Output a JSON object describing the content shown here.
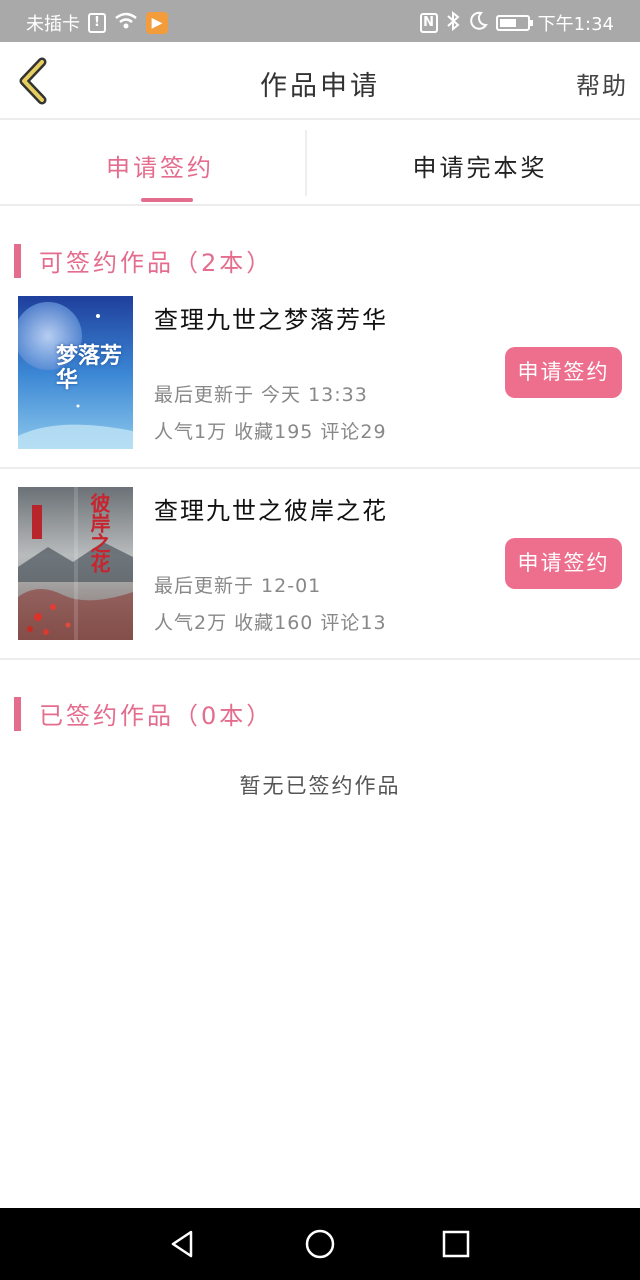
{
  "status_bar": {
    "carrier": "未插卡",
    "alert_icon": "!",
    "wifi_icon": "wifi-icon",
    "app_icon": "▶",
    "nfc_icon": "N",
    "bluetooth_icon": "bluetooth-icon",
    "moon_icon": "moon-icon",
    "battery_level": 0.6,
    "time": "下午1:34"
  },
  "header": {
    "back_icon": "chevron-left-icon",
    "title": "作品申请",
    "help": "帮助"
  },
  "tabs": [
    {
      "label": "申请签约",
      "active": true
    },
    {
      "label": "申请完本奖",
      "active": false
    }
  ],
  "signable": {
    "title": "可签约作品（2本）",
    "books": [
      {
        "title": "查理九世之梦落芳华",
        "updated": "最后更新于 今天 13:33",
        "stats": "人气1万 收藏195 评论29",
        "button": "申请签约",
        "cover_text": "梦落芳华"
      },
      {
        "title": "查理九世之彼岸之花",
        "updated": "最后更新于 12-01",
        "stats": "人气2万 收藏160 评论13",
        "button": "申请签约",
        "cover_text": "彼岸之花"
      }
    ]
  },
  "signed": {
    "title": "已签约作品（0本）",
    "empty": "暂无已签约作品"
  },
  "nav": {
    "back_icon": "triangle-back-icon",
    "home_icon": "circle-home-icon",
    "recent_icon": "square-recent-icon"
  },
  "colors": {
    "accent": "#e46d8e",
    "button": "#ee6e8d",
    "status_bar": "#a9a9a9"
  }
}
